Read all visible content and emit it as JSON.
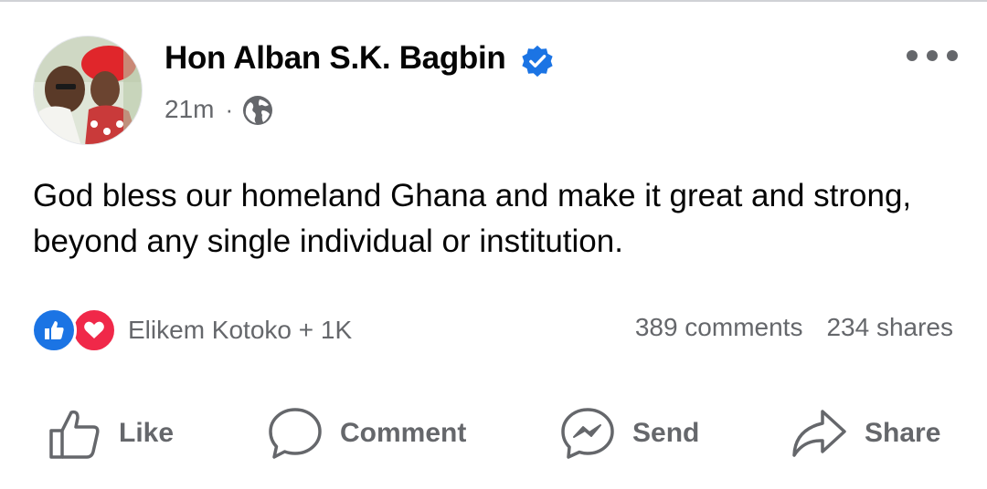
{
  "post": {
    "author": "Hon Alban S.K. Bagbin",
    "verified": true,
    "time": "21m",
    "separator": "·",
    "audience_icon": "globe-icon",
    "text": "God bless our homeland Ghana and make it great and strong, beyond any single individual or institution.",
    "more_icon": "more-options-icon"
  },
  "engagement": {
    "reaction_icons": [
      "like-reaction-icon",
      "love-reaction-icon"
    ],
    "reactions_label": "Elikem Kotoko + 1K",
    "comments": "389 comments",
    "shares": "234 shares"
  },
  "actions": {
    "like": "Like",
    "comment": "Comment",
    "send": "Send",
    "share": "Share"
  },
  "colors": {
    "brand_blue": "#1b74e4",
    "love_red": "#f02849",
    "secondary_text": "#65676b",
    "primary_text": "#050505"
  }
}
